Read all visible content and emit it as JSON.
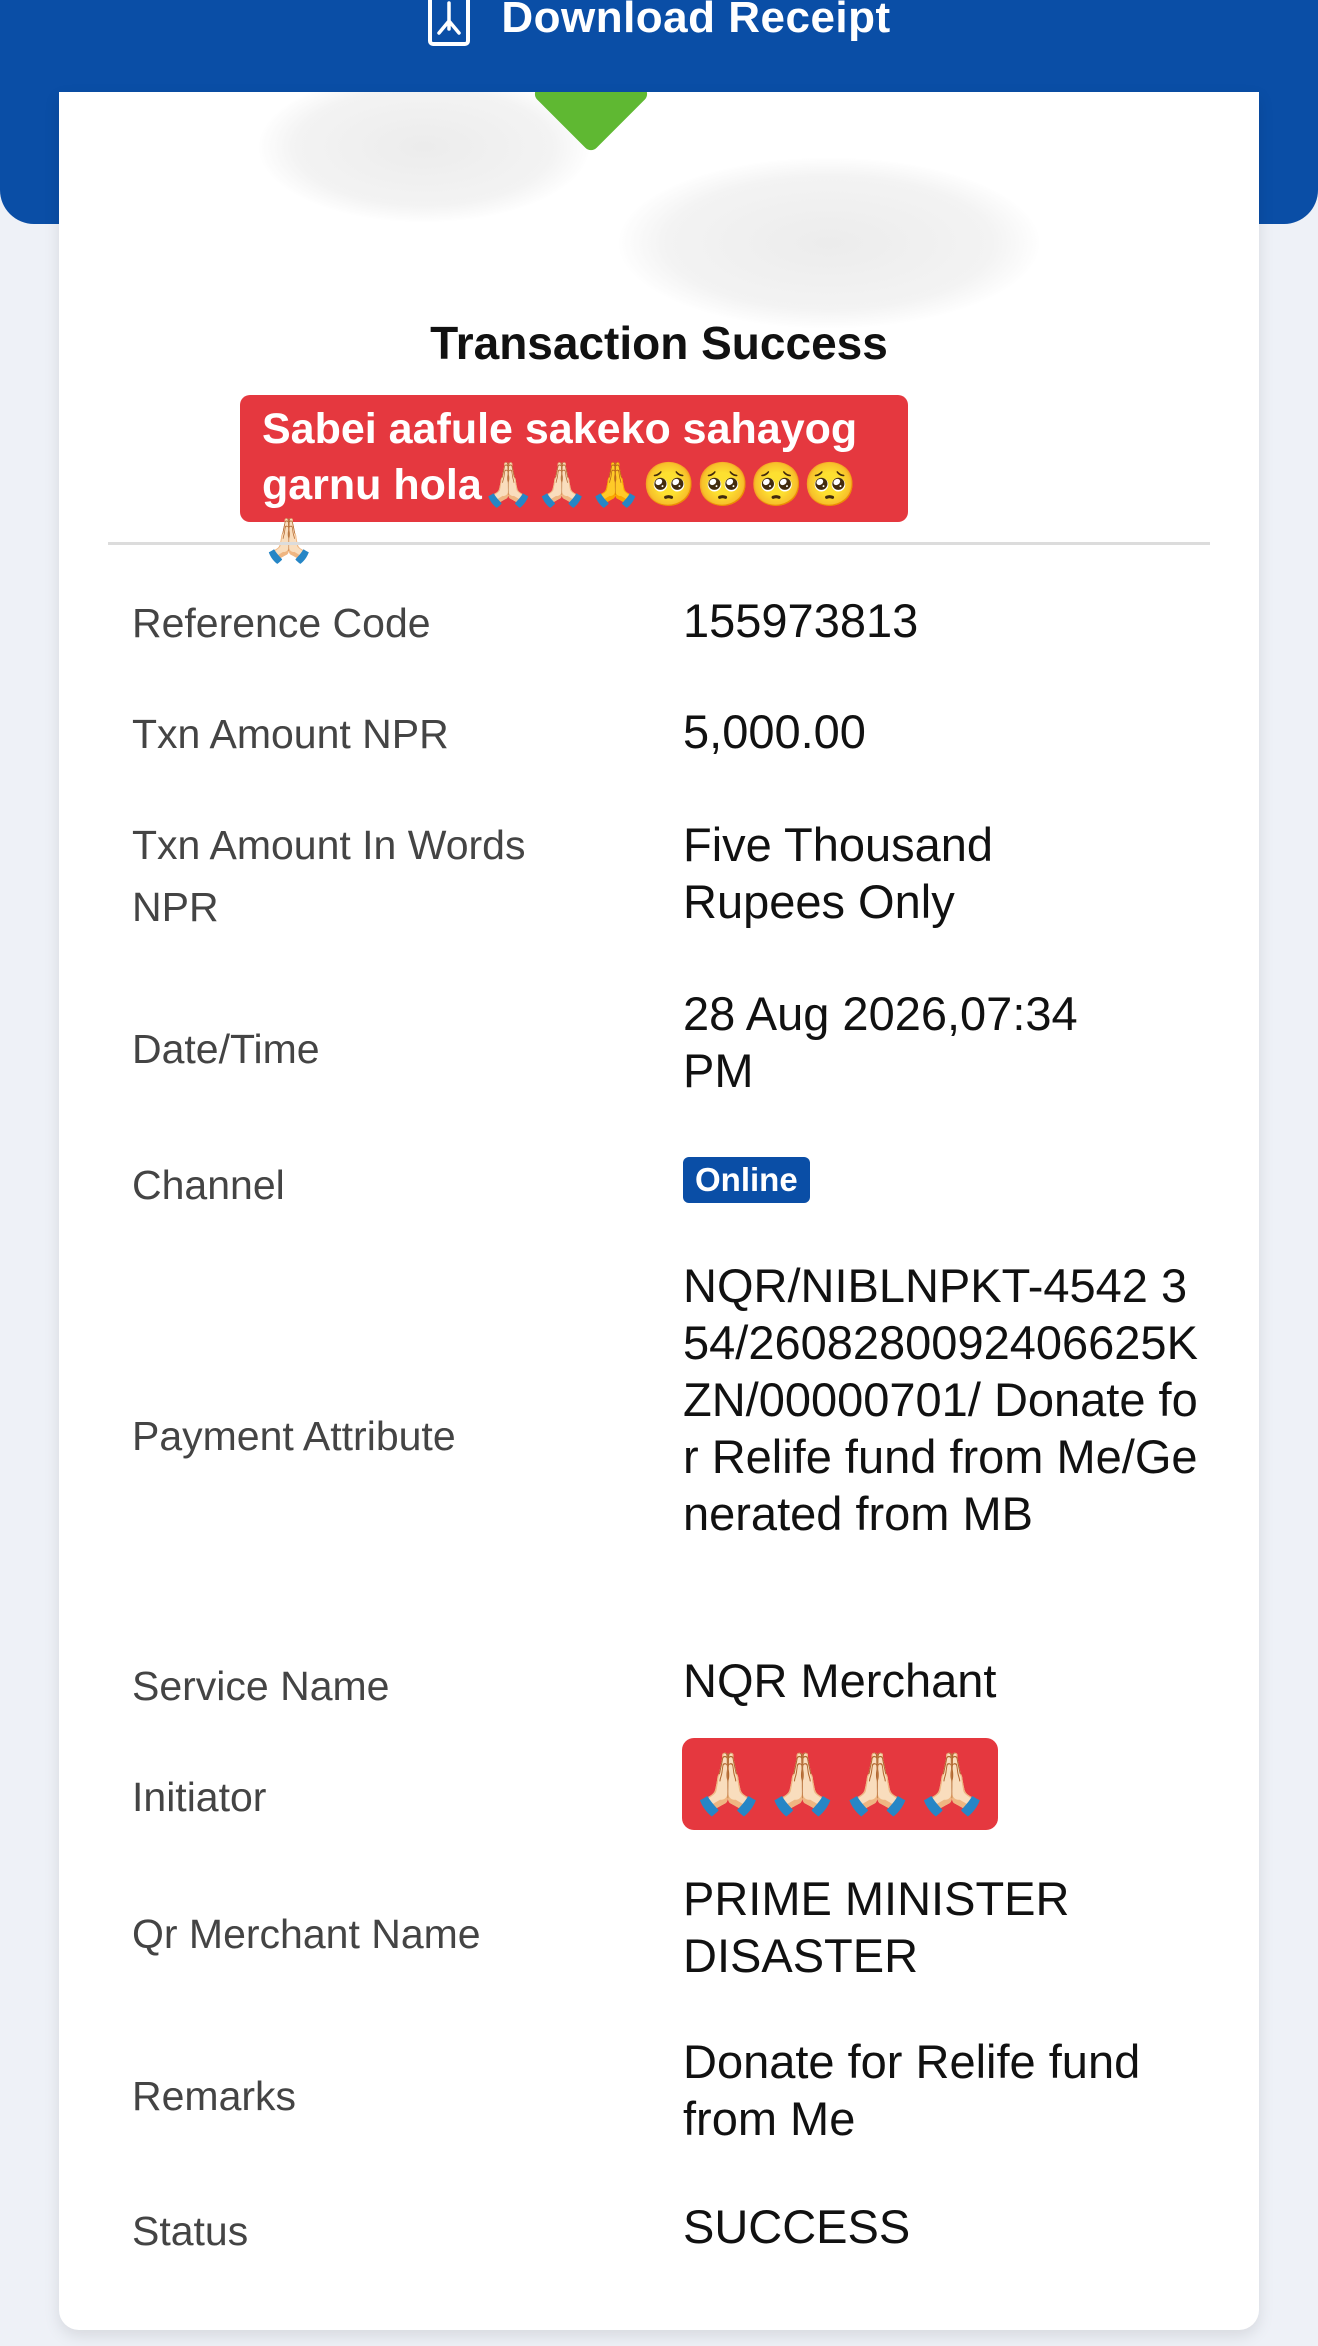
{
  "header": {
    "download_label": "Download Receipt"
  },
  "card": {
    "title": "Transaction Success",
    "sticker_text": "Sabei aafule sakeko sahayog\ngarnu hola🙏🏻🙏🏻🙏🥺🥺🥺🥺🙏🏻"
  },
  "rows": [
    {
      "label": "Reference Code",
      "value": "155973813"
    },
    {
      "label": "Txn Amount NPR",
      "value": "5,000.00"
    },
    {
      "label": "Txn Amount In Words NPR",
      "value": "Five Thousand Rupees Only"
    },
    {
      "label": "Date/Time",
      "value": "28 Aug 2026,07:34 PM"
    },
    {
      "label": "Channel",
      "value": "Online"
    },
    {
      "label": "Payment Attribute",
      "value": "NQR/NIBLNPKT-4542 354/2608280092406625KZN/00000701/ Donate for Relife fund from Me/Generated from MB"
    },
    {
      "label": "Service Name",
      "value": "NQR Merchant"
    },
    {
      "label": "Initiator",
      "value": "🙏🏻🙏🏻🙏🏻🙏🏻"
    },
    {
      "label": "Qr Merchant Name",
      "value": "PRIME MINISTER DISASTER"
    },
    {
      "label": "Remarks",
      "value": "Donate for Relife fund from Me"
    },
    {
      "label": "Status",
      "value": "SUCCESS"
    }
  ],
  "colors": {
    "brand_blue": "#0a4ea6",
    "success_green": "#5fb832",
    "sticker_red": "#e5383f",
    "background": "#eef1f7"
  },
  "icons": {
    "download": "pdf-document-icon"
  }
}
